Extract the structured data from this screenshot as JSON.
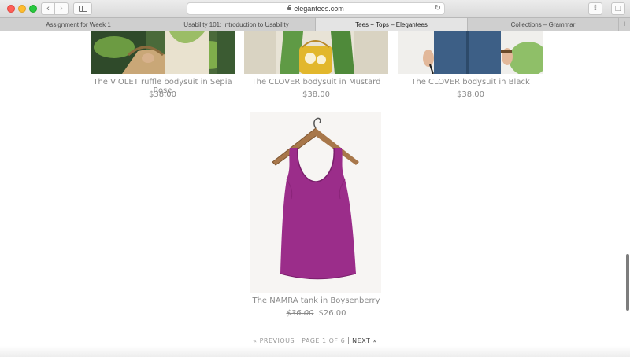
{
  "browser": {
    "url": "elegantees.com",
    "tabs": [
      {
        "label": "Assignment for Week 1",
        "active": false
      },
      {
        "label": "Usability 101: Introduction to Usability",
        "active": false
      },
      {
        "label": "Tees + Tops – Elegantees",
        "active": true
      },
      {
        "label": "Collections – Grammar",
        "active": false
      }
    ],
    "new_tab_label": "+"
  },
  "products": [
    {
      "title": "The VIOLET ruffle bodysuit in Sepia Rose",
      "price": "$38.00"
    },
    {
      "title": "The CLOVER bodysuit in Mustard",
      "price": "$38.00"
    },
    {
      "title": "The CLOVER bodysuit in Black",
      "price": "$38.00"
    },
    {
      "title": "The NAMRA tank in Boysenberry",
      "price_original": "$36.00",
      "price": "$26.00"
    }
  ],
  "pagination": {
    "previous": "« PREVIOUS",
    "page_info": "PAGE 1 OF 6",
    "next": "NEXT »"
  },
  "colors": {
    "tank": "#9b2d8a",
    "text_muted": "#8a8a8a",
    "next_link": "#444444"
  }
}
